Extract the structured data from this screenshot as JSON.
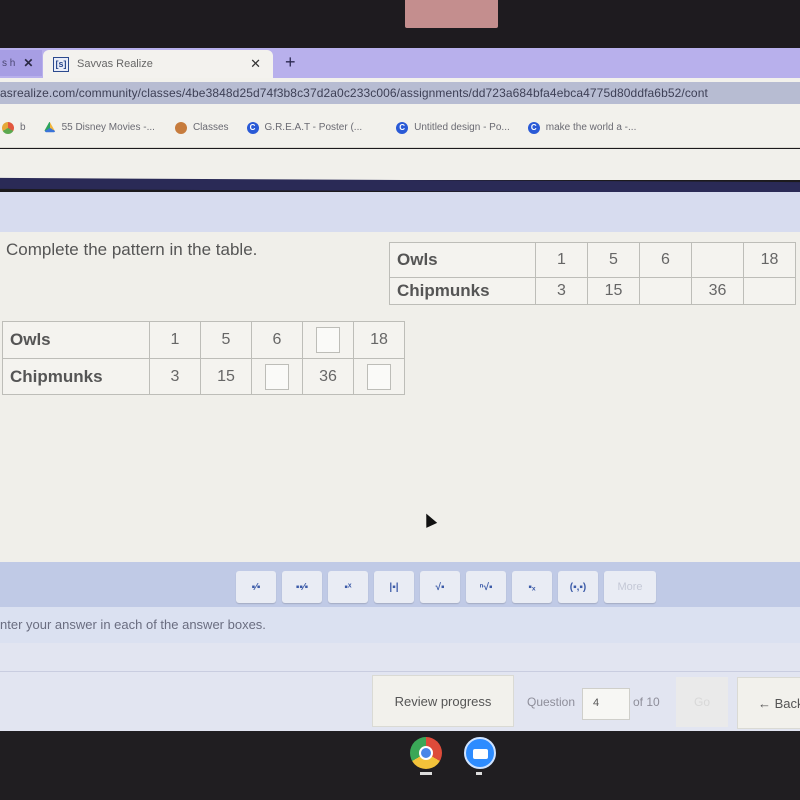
{
  "browser": {
    "prev_tab_label": "s h",
    "active_tab": {
      "title": "Savvas Realize",
      "favicon": "[s]"
    },
    "new_tab_symbol": "+",
    "close_symbol": "✕",
    "url": "asrealize.com/community/classes/4be3848d25d74f3b8c37d2a0c233c006/assignments/dd723a684bfa4ebca4775d80ddfa6b52/cont",
    "bookmarks": [
      {
        "label": "b",
        "icon": "cube-icon"
      },
      {
        "label": "55 Disney Movies -...",
        "icon": "drive-icon"
      },
      {
        "label": "Classes",
        "icon": "classes-icon"
      },
      {
        "label": "G.R.E.A.T - Poster (...",
        "icon": "canva-icon",
        "glyph": "C"
      },
      {
        "label": "Untitled design - Po...",
        "icon": "canva-icon",
        "glyph": "C"
      },
      {
        "label": "make the world a -...",
        "icon": "canva-icon",
        "glyph": "C"
      }
    ]
  },
  "question": {
    "prompt": "Complete the pattern in the table.",
    "reference_table": {
      "rows": [
        {
          "label": "Owls",
          "cells": [
            "1",
            "5",
            "6",
            "",
            "18"
          ]
        },
        {
          "label": "Chipmunks",
          "cells": [
            "3",
            "15",
            "",
            "36",
            ""
          ]
        }
      ]
    },
    "answer_table": {
      "rows": [
        {
          "label": "Owls",
          "cells": [
            {
              "value": "1"
            },
            {
              "value": "5"
            },
            {
              "value": "6"
            },
            {
              "input": true,
              "value": ""
            },
            {
              "value": "18"
            }
          ]
        },
        {
          "label": "Chipmunks",
          "cells": [
            {
              "value": "3"
            },
            {
              "value": "15"
            },
            {
              "input": true,
              "value": ""
            },
            {
              "value": "36"
            },
            {
              "input": true,
              "value": ""
            }
          ]
        }
      ]
    }
  },
  "math_toolbar": {
    "buttons": [
      {
        "name": "fraction",
        "glyph": "▪⁄▪"
      },
      {
        "name": "mixed-number",
        "glyph": "▪▪⁄▪"
      },
      {
        "name": "exponent",
        "glyph": "▪ˣ"
      },
      {
        "name": "absolute-value",
        "glyph": "|▪|"
      },
      {
        "name": "square-root",
        "glyph": "√▪"
      },
      {
        "name": "nth-root",
        "glyph": "ⁿ√▪"
      },
      {
        "name": "subscript",
        "glyph": "▪ₓ"
      },
      {
        "name": "ordered-pair",
        "glyph": "(▪,▪)"
      },
      {
        "name": "more",
        "glyph": "More"
      }
    ]
  },
  "instruction": "nter your answer in each of the answer boxes.",
  "footer": {
    "review_label": "Review progress",
    "question_label": "Question",
    "question_number": "4",
    "of_label": "of 10",
    "go_label": "Go",
    "back_label": "← Back"
  },
  "dock": [
    {
      "name": "chrome",
      "active": true
    },
    {
      "name": "zoom",
      "active": true
    }
  ]
}
